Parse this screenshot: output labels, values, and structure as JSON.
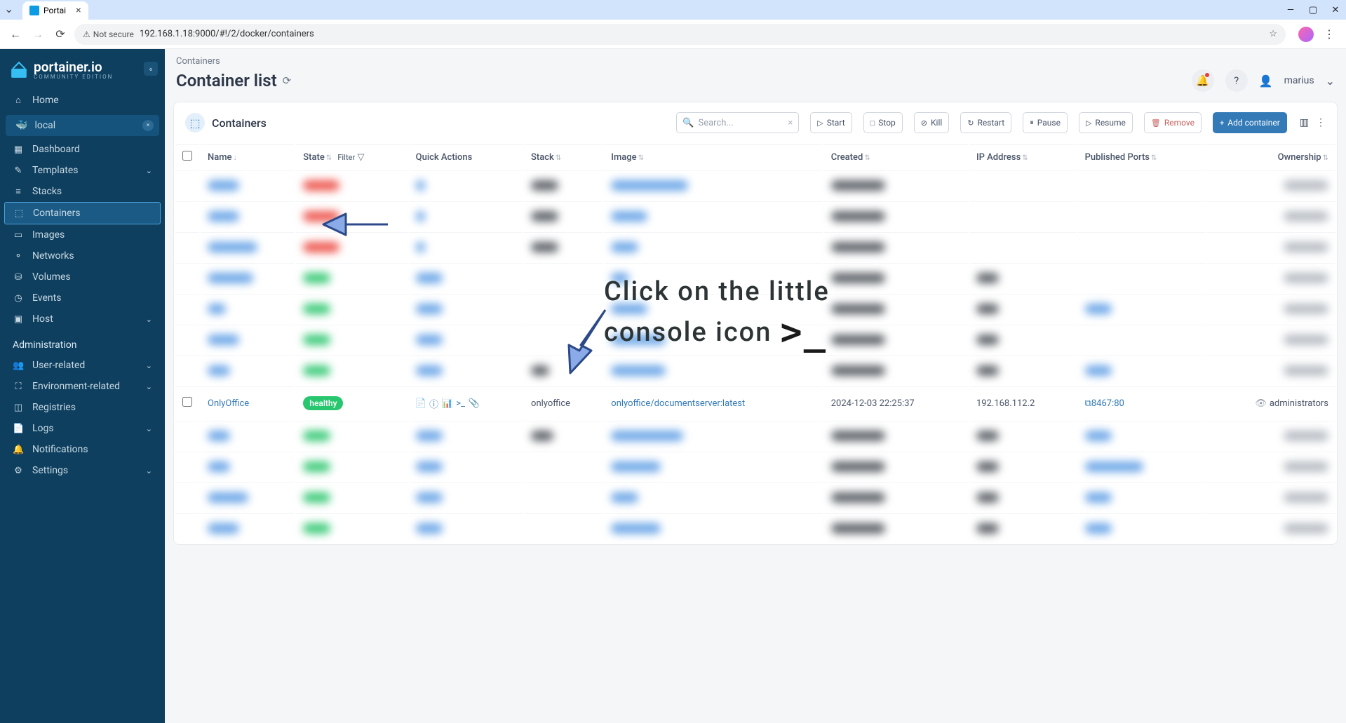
{
  "browser": {
    "tab_title": "Portai",
    "not_secure": "Not secure",
    "url": "192.168.1.18:9000/#!/2/docker/containers"
  },
  "sidebar": {
    "brand": "portainer.io",
    "brand_sub": "COMMUNITY EDITION",
    "home": "Home",
    "env_name": "local",
    "items": [
      "Dashboard",
      "Templates",
      "Stacks",
      "Containers",
      "Images",
      "Networks",
      "Volumes",
      "Events",
      "Host"
    ],
    "admin_label": "Administration",
    "admin_items": [
      "User-related",
      "Environment-related",
      "Registries",
      "Logs",
      "Notifications",
      "Settings"
    ]
  },
  "header": {
    "breadcrumb": "Containers",
    "title": "Container list",
    "username": "marius"
  },
  "toolbar": {
    "card_title": "Containers",
    "search_placeholder": "Search...",
    "start": "Start",
    "stop": "Stop",
    "kill": "Kill",
    "restart": "Restart",
    "pause": "Pause",
    "resume": "Resume",
    "remove": "Remove",
    "add": "Add container"
  },
  "columns": {
    "name": "Name",
    "state": "State",
    "filter": "Filter",
    "quick": "Quick Actions",
    "stack": "Stack",
    "image": "Image",
    "created": "Created",
    "ip": "IP Address",
    "ports": "Published Ports",
    "ownership": "Ownership"
  },
  "row": {
    "name": "OnlyOffice",
    "state": "healthy",
    "stack": "onlyoffice",
    "image": "onlyoffice/documentserver:latest",
    "created": "2024-12-03 22:25:37",
    "ip": "192.168.112.2",
    "port": "8467:80",
    "ownership": "administrators"
  },
  "annotation": {
    "line1": "Click on the little",
    "line2": "console icon"
  }
}
